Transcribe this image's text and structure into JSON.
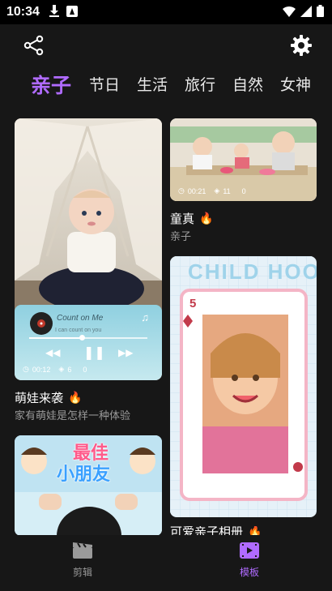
{
  "status": {
    "time": "10:34"
  },
  "tabs": [
    {
      "label": "亲子",
      "active": true
    },
    {
      "label": "节日",
      "active": false
    },
    {
      "label": "生活",
      "active": false
    },
    {
      "label": "旅行",
      "active": false
    },
    {
      "label": "自然",
      "active": false
    },
    {
      "label": "女神",
      "active": false
    }
  ],
  "cards": {
    "baby": {
      "title": "萌娃来袭",
      "subtitle": "家有萌娃是怎样一种体验",
      "duration": "00:12",
      "layers": "6",
      "count": "0",
      "player": {
        "song": "Count on Me",
        "lyric": "I can count on you"
      }
    },
    "innocence": {
      "title": "童真",
      "subtitle": "亲子",
      "duration": "00:21",
      "layers": "11",
      "count": "0"
    },
    "bestkids": {
      "text_top": "最佳",
      "text_bottom": "小朋友"
    },
    "album": {
      "title": "可爱亲子相册",
      "header_text": "CHILD HOOD",
      "card_number": "5"
    }
  },
  "bottom_nav": [
    {
      "label": "剪辑",
      "active": false
    },
    {
      "label": "模板",
      "active": true
    }
  ],
  "colors": {
    "accent": "#b06bff",
    "background": "#171717",
    "flame": "#ff8a00"
  }
}
